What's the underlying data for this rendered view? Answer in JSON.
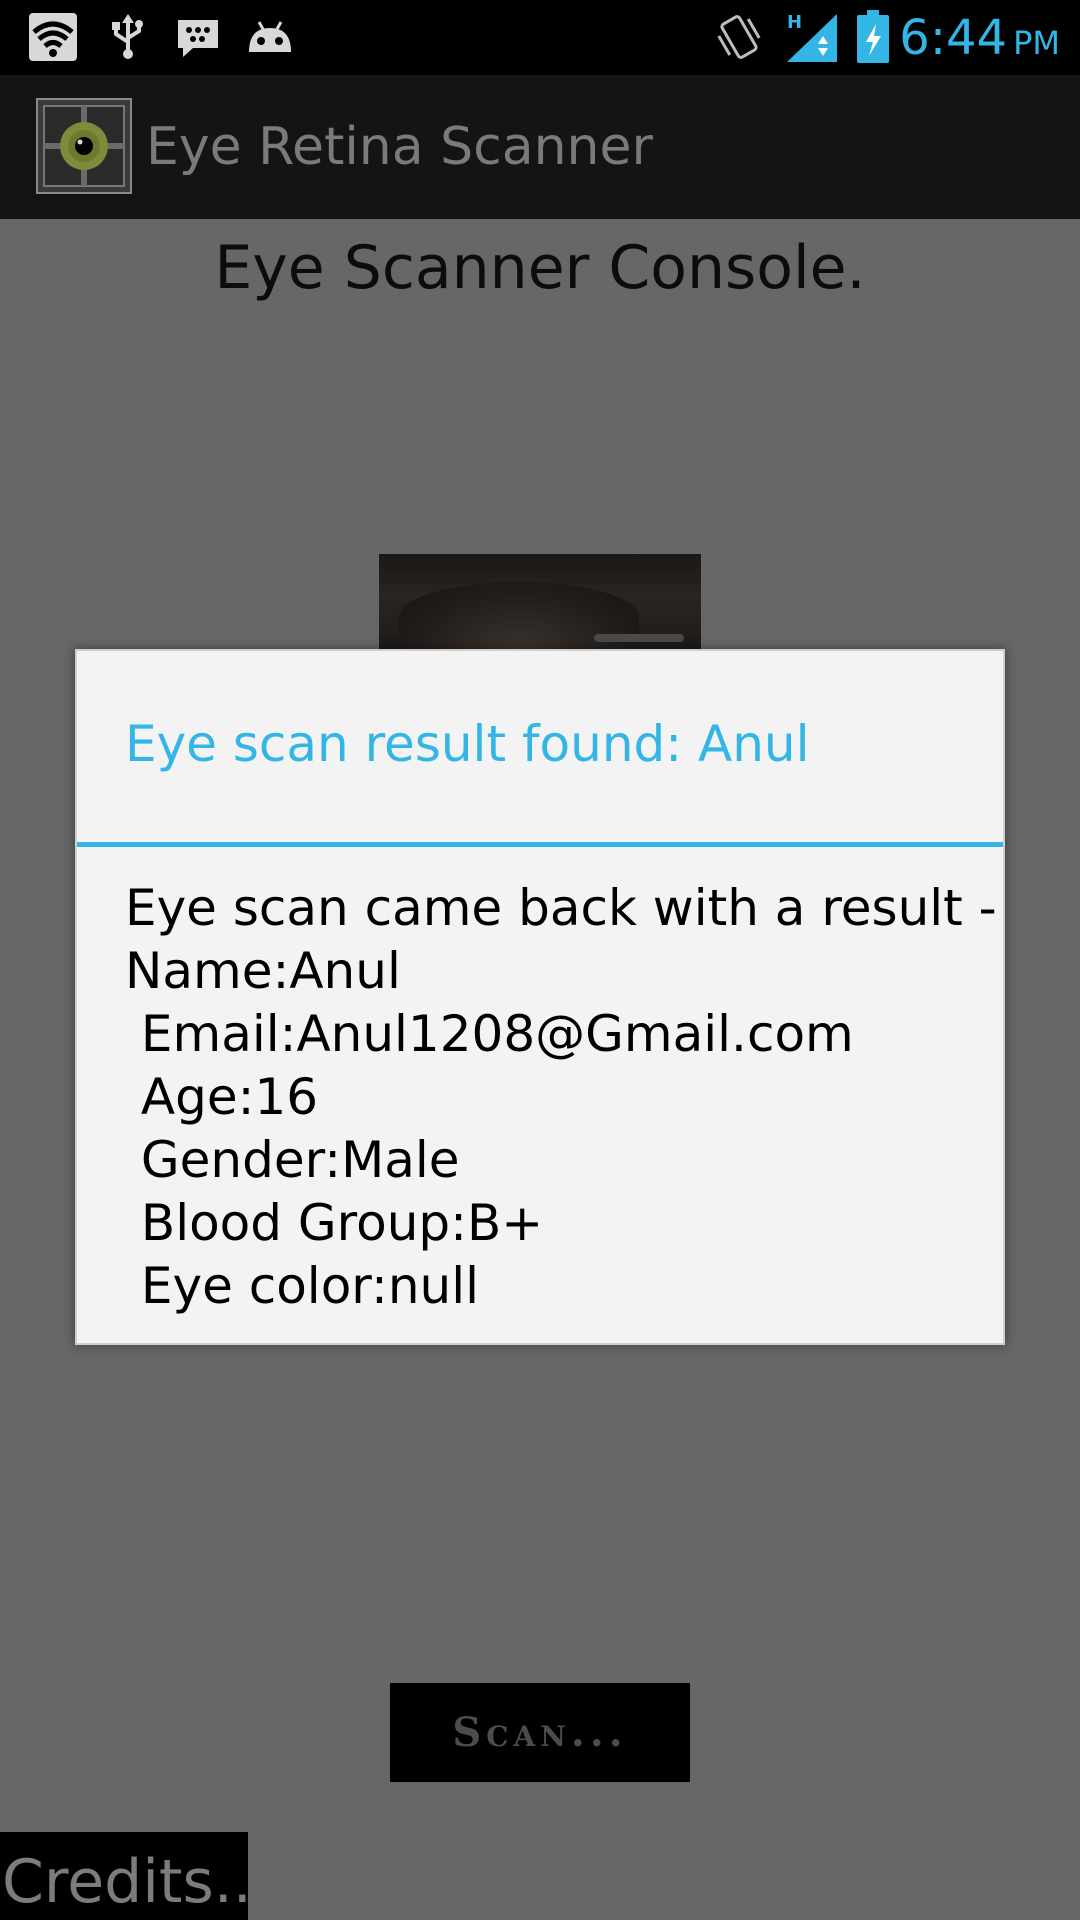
{
  "status_bar": {
    "time": "6:44",
    "ampm": "PM",
    "network_type": "H",
    "left_icons": [
      "wifi-icon",
      "usb-icon",
      "bbm-icon",
      "android-icon"
    ],
    "right_icons": [
      "vibrate-icon",
      "signal-icon",
      "battery-charging-icon"
    ],
    "accent_color": "#33b5e5"
  },
  "app_bar": {
    "title": "Eye Retina Scanner",
    "icon": "eye-logo-icon"
  },
  "console": {
    "title": "Eye Scanner Console.",
    "scan_button_label": "Scan...",
    "credits_label": "Credits.."
  },
  "dialog": {
    "title": "Eye scan result found: Anul",
    "lines": [
      "Eye scan came back with a result -",
      "Name:Anul",
      " Email:Anul1208@Gmail.com",
      " Age:16",
      " Gender:Male",
      " Blood Group:B+",
      " Eye color:null"
    ]
  }
}
